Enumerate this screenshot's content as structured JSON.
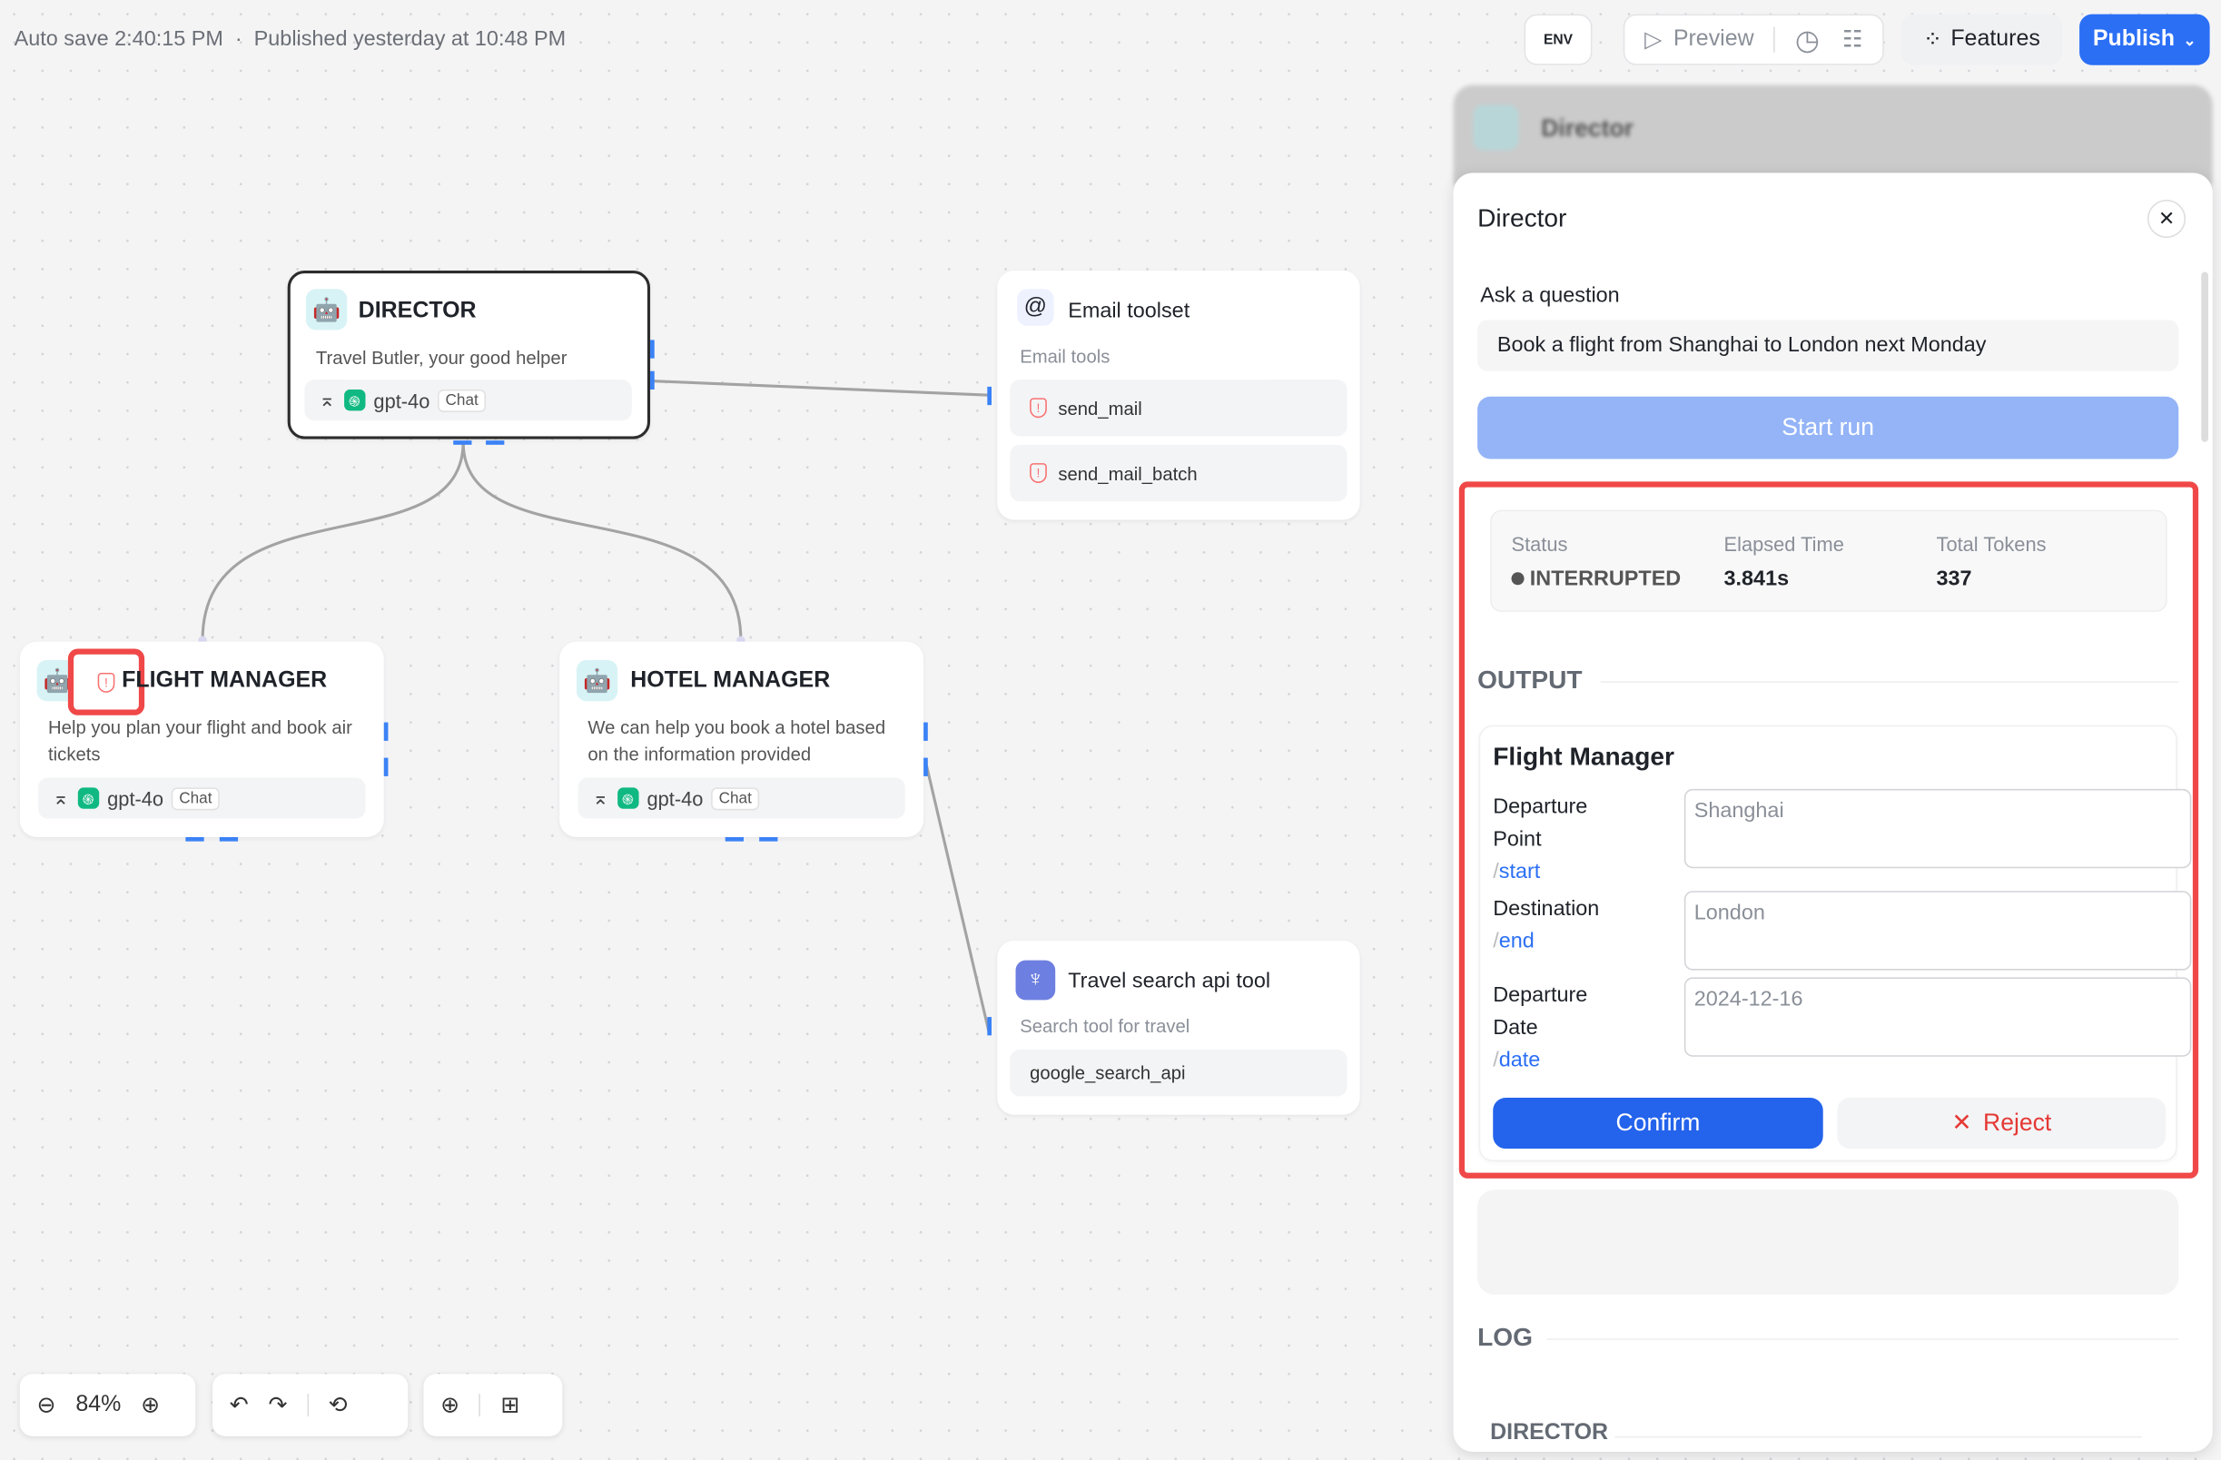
{
  "header": {
    "autosave": "Auto save 2:40:15 PM",
    "separator": "·",
    "published": "Published yesterday at 10:48 PM",
    "env_label": "ENV",
    "preview_label": "Preview",
    "features_label": "Features",
    "publish_label": "Publish"
  },
  "canvas": {
    "director": {
      "title": "DIRECTOR",
      "desc": "Travel Butler, your good helper",
      "model": "gpt-4o",
      "mode": "Chat"
    },
    "email": {
      "title": "Email toolset",
      "desc": "Email tools",
      "tools": [
        "send_mail",
        "send_mail_batch"
      ]
    },
    "flight": {
      "title": "FLIGHT MANAGER",
      "desc": "Help you plan your flight and book air tickets",
      "model": "gpt-4o",
      "mode": "Chat"
    },
    "hotel": {
      "title": "HOTEL MANAGER",
      "desc": "We can help you book a hotel based on the information provided",
      "model": "gpt-4o",
      "mode": "Chat"
    },
    "search": {
      "title": "Travel search api tool",
      "desc": "Search tool for travel",
      "tools": [
        "google_search_api"
      ]
    }
  },
  "toolbar": {
    "zoom": "84%"
  },
  "blurred_panel": {
    "title": "Director"
  },
  "panel": {
    "title": "Director",
    "ask_label": "Ask a question",
    "question": "Book a flight from Shanghai to London next Monday",
    "start_label": "Start run",
    "status_label": "Status",
    "status_value": "INTERRUPTED",
    "elapsed_label": "Elapsed Time",
    "elapsed_value": "3.841s",
    "tokens_label": "Total Tokens",
    "tokens_value": "337",
    "output_label": "OUTPUT",
    "card_title": "Flight Manager",
    "fields": [
      {
        "label": "Departure Point",
        "var": "start",
        "value": "Shanghai"
      },
      {
        "label": "Destination",
        "var": "end",
        "value": "London"
      },
      {
        "label": "Departure Date",
        "var": "date",
        "value": "2024-12-16"
      }
    ],
    "confirm_label": "Confirm",
    "reject_label": "Reject",
    "log_label": "LOG",
    "log_section": "DIRECTOR"
  },
  "colors": {
    "accent": "#2b6ff5",
    "highlight": "#f04848",
    "start_run": "#94b4f7"
  }
}
